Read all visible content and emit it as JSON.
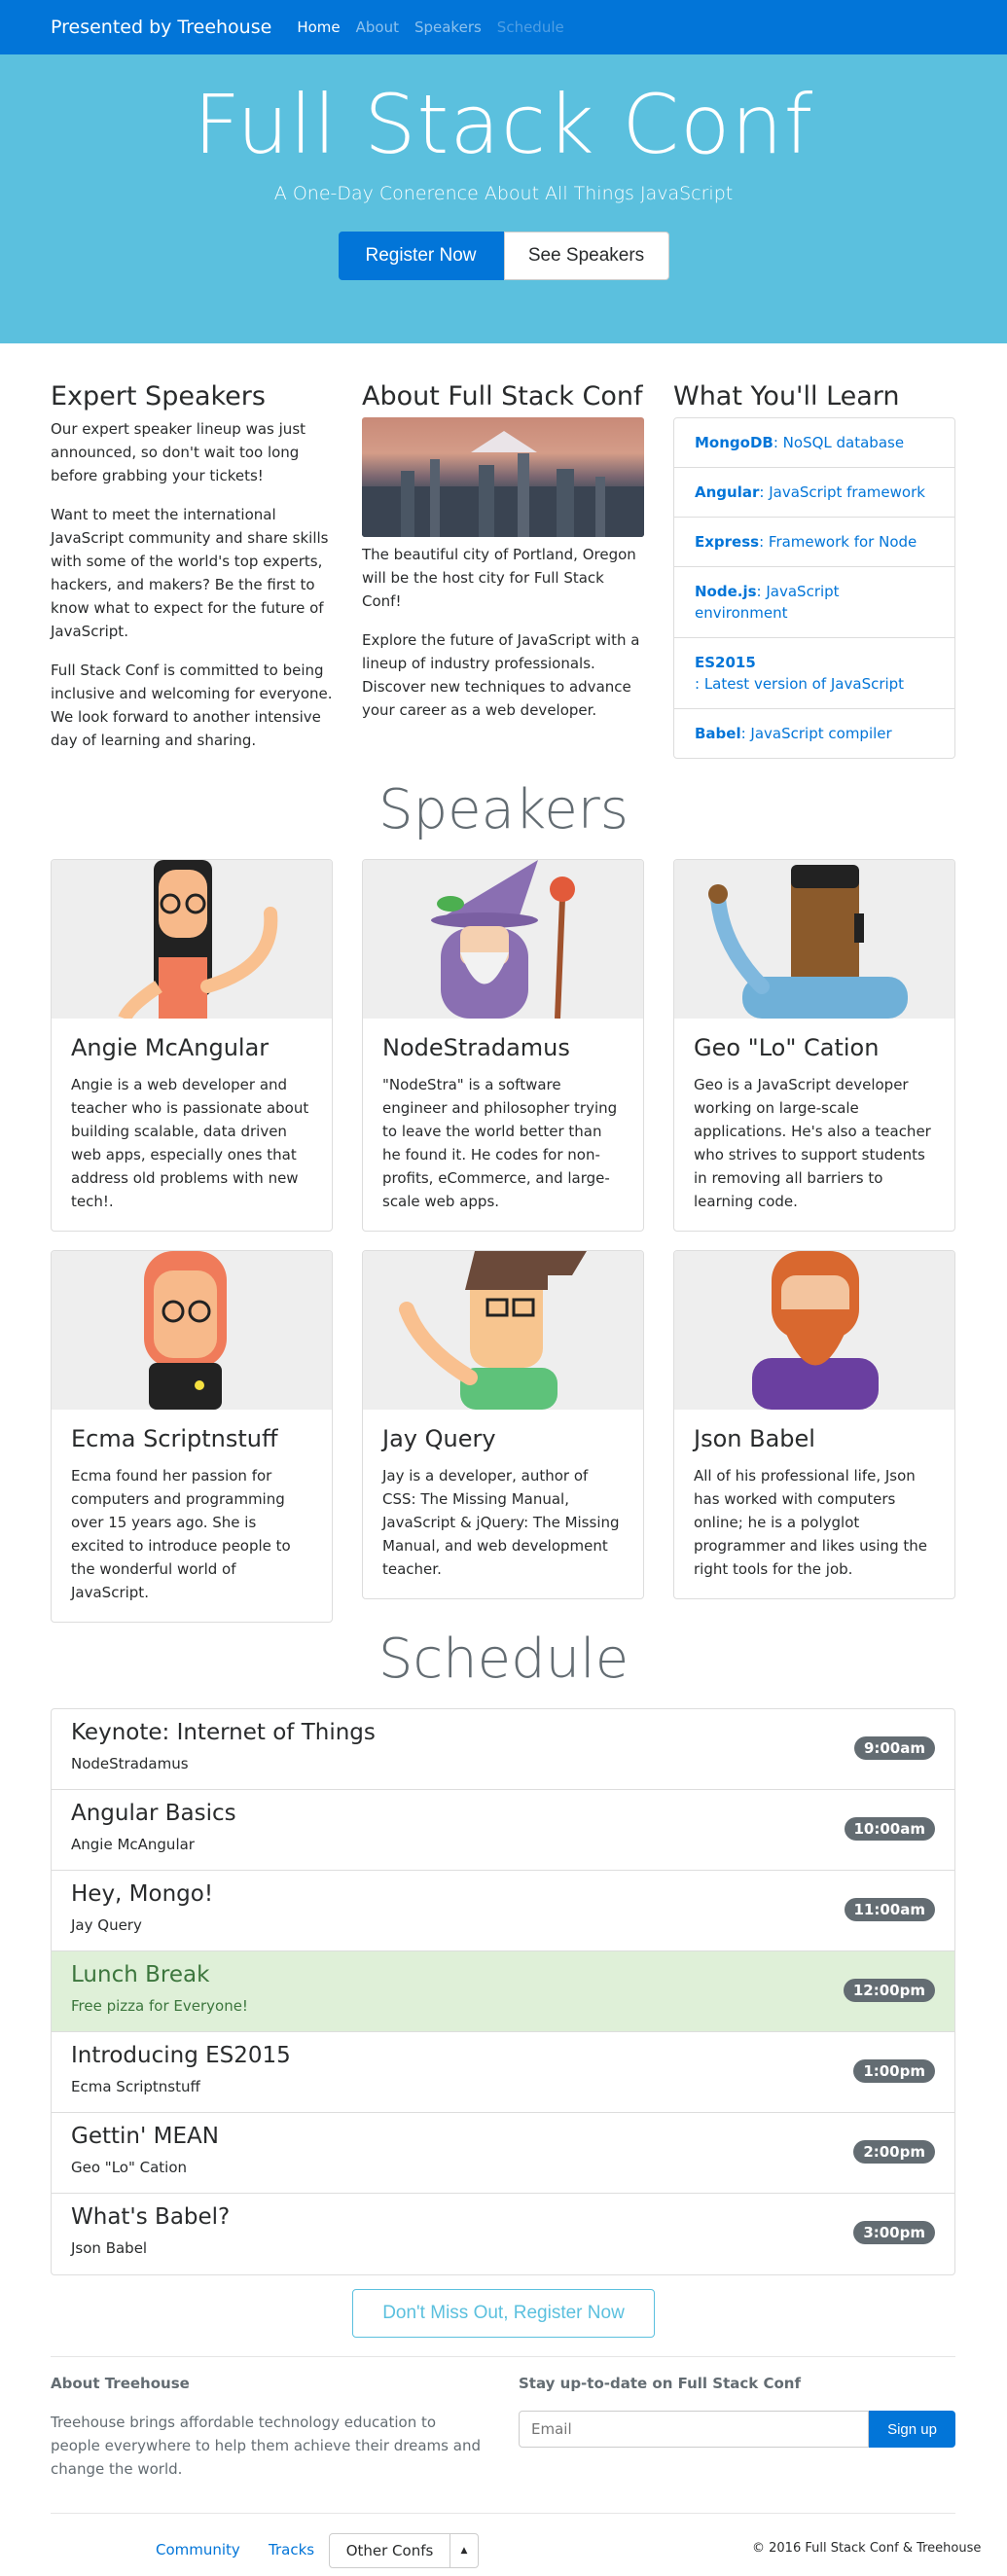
{
  "nav": {
    "brand": "Presented by Treehouse",
    "links": [
      "Home",
      "About",
      "Speakers",
      "Schedule"
    ]
  },
  "hero": {
    "title": "Full Stack Conf",
    "subtitle": "A One-Day Conerence About All Things JavaScript",
    "register": "Register Now",
    "see_speakers": "See Speakers"
  },
  "expert": {
    "title": "Expert Speakers",
    "p1": "Our expert speaker lineup was just announced, so don't wait too long before grabbing your tickets!",
    "p2": "Want to meet the international JavaScript community and share skills with some of the world's top experts, hackers, and makers? Be the first to know what to expect for the future of JavaScript.",
    "p3": "Full Stack Conf is committed to being inclusive and welcoming for everyone. We look forward to another intensive day of learning and sharing."
  },
  "about": {
    "title": "About Full Stack Conf",
    "caption": "The beautiful city of Portland, Oregon will be the host city for Full Stack Conf!",
    "p2": "Explore the future of JavaScript with a lineup of industry professionals. Discover new techniques to advance your career as a web developer."
  },
  "learn": {
    "title": "What You'll Learn",
    "items": [
      {
        "name": "MongoDB",
        "desc": ": NoSQL database"
      },
      {
        "name": "Angular",
        "desc": ": JavaScript framework"
      },
      {
        "name": "Express",
        "desc": ": Framework for Node"
      },
      {
        "name": "Node.js",
        "desc": ": JavaScript environment"
      },
      {
        "name": "ES2015",
        "desc": ": Latest version of JavaScript"
      },
      {
        "name": "Babel",
        "desc": ": JavaScript compiler"
      }
    ]
  },
  "speakers": {
    "heading": "Speakers",
    "items": [
      {
        "name": "Angie McAngular",
        "bio": "Angie is a web developer and teacher who is passionate about building scalable, data driven web apps, especially ones that address old problems with new tech!."
      },
      {
        "name": "NodeStradamus",
        "bio": "\"NodeStra\" is a software engineer and philosopher trying to leave the world better than he found it. He codes for non-profits, eCommerce, and large-scale web apps."
      },
      {
        "name": "Geo \"Lo\" Cation",
        "bio": "Geo is a JavaScript developer working on large-scale applications. He's also a teacher who strives to support students in removing all barriers to learning code."
      },
      {
        "name": "Ecma Scriptnstuff",
        "bio": "Ecma found her passion for computers and programming over 15 years ago. She is excited to introduce people to the wonderful world of JavaScript."
      },
      {
        "name": "Jay Query",
        "bio": "Jay is a developer, author of CSS: The Missing Manual, JavaScript & jQuery: The Missing Manual, and web development teacher."
      },
      {
        "name": "Json Babel",
        "bio": "All of his professional life, Json has worked with computers online; he is a polyglot programmer and likes using the right tools for the job."
      }
    ]
  },
  "schedule": {
    "heading": "Schedule",
    "items": [
      {
        "title": "Keynote: Internet of Things",
        "sub": "NodeStradamus",
        "time": "9:00am"
      },
      {
        "title": "Angular Basics",
        "sub": "Angie McAngular",
        "time": "10:00am"
      },
      {
        "title": "Hey, Mongo!",
        "sub": "Jay Query",
        "time": "11:00am"
      },
      {
        "title": "Lunch Break",
        "sub": "Free pizza for Everyone!",
        "time": "12:00pm"
      },
      {
        "title": "Introducing ES2015",
        "sub": "Ecma Scriptnstuff",
        "time": "1:00pm"
      },
      {
        "title": "Gettin' MEAN",
        "sub": "Geo \"Lo\" Cation",
        "time": "2:00pm"
      },
      {
        "title": "What's Babel?",
        "sub": "Json Babel",
        "time": "3:00pm"
      }
    ]
  },
  "cta": "Don't Miss Out, Register Now",
  "footer": {
    "about_title": "About Treehouse",
    "about_text": "Treehouse brings affordable technology education to people everywhere to help them achieve their dreams and change the world.",
    "news_title": "Stay up-to-date on Full Stack Conf",
    "email_placeholder": "Email",
    "signup": "Sign up",
    "community": "Community",
    "tracks": "Tracks",
    "other": "Other Confs",
    "copyright": "© 2016 Full Stack Conf & Treehouse"
  }
}
